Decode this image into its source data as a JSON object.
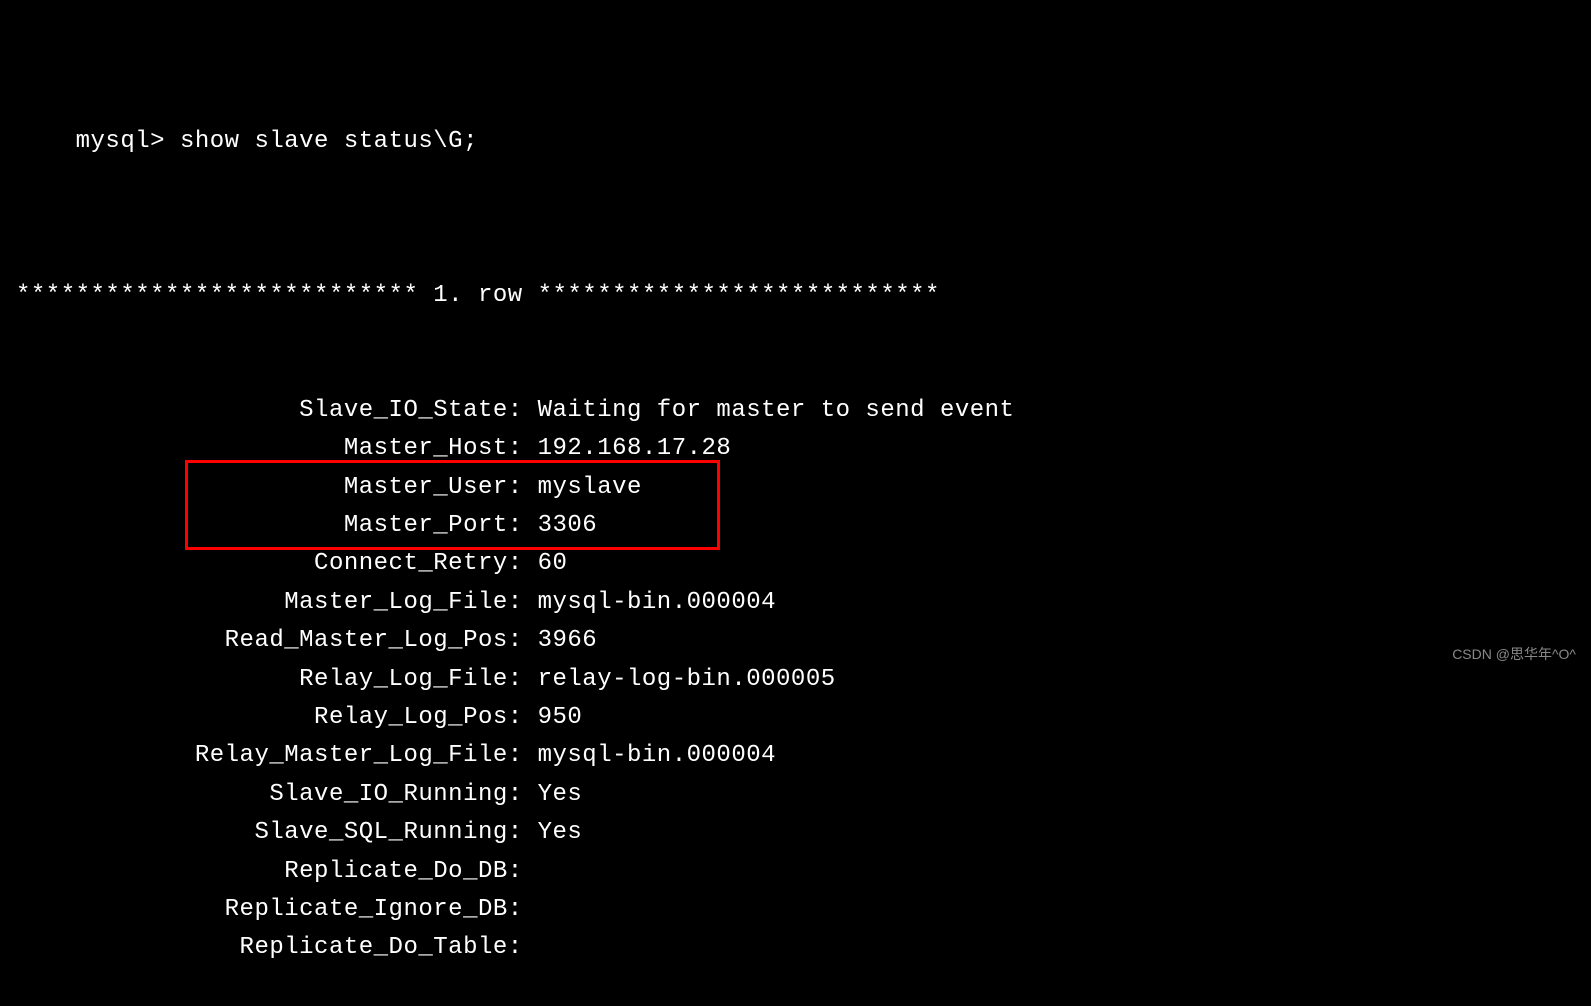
{
  "prompt": "mysql> ",
  "command": "show slave status\\G;",
  "row_header": "*************************** 1. row ***************************",
  "fields": [
    {
      "label": "Slave_IO_State",
      "value": "Waiting for master to send event"
    },
    {
      "label": "Master_Host",
      "value": "192.168.17.28"
    },
    {
      "label": "Master_User",
      "value": "myslave"
    },
    {
      "label": "Master_Port",
      "value": "3306"
    },
    {
      "label": "Connect_Retry",
      "value": "60"
    },
    {
      "label": "Master_Log_File",
      "value": "mysql-bin.000004"
    },
    {
      "label": "Read_Master_Log_Pos",
      "value": "3966"
    },
    {
      "label": "Relay_Log_File",
      "value": "relay-log-bin.000005"
    },
    {
      "label": "Relay_Log_Pos",
      "value": "950"
    },
    {
      "label": "Relay_Master_Log_File",
      "value": "mysql-bin.000004"
    },
    {
      "label": "Slave_IO_Running",
      "value": "Yes"
    },
    {
      "label": "Slave_SQL_Running",
      "value": "Yes"
    },
    {
      "label": "Replicate_Do_DB",
      "value": ""
    },
    {
      "label": "Replicate_Ignore_DB",
      "value": ""
    },
    {
      "label": "Replicate_Do_Table",
      "value": ""
    }
  ],
  "watermark": "CSDN @思华年^O^"
}
